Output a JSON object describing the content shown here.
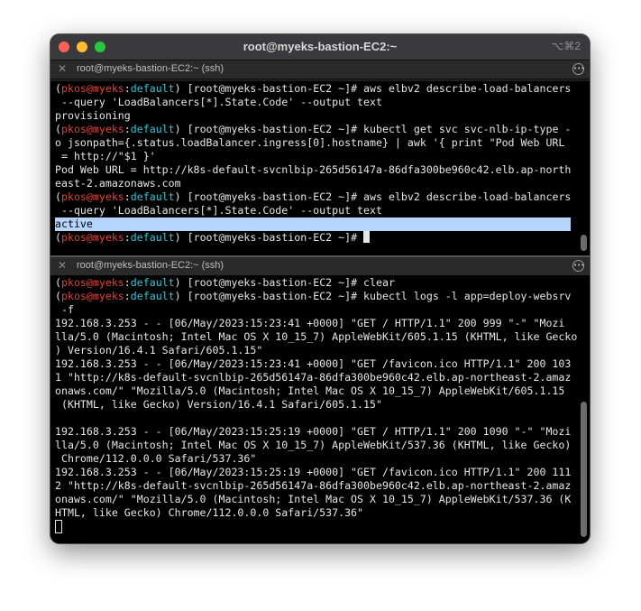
{
  "window": {
    "title": "root@myeks-bastion-EC2:~",
    "shortcut": "⌥⌘2"
  },
  "panes": [
    {
      "tab_title": "root@myeks-bastion-EC2:~ (ssh)",
      "lines": [
        {
          "user": "pkos",
          "at": "@",
          "host": "myeks",
          "colon": ":",
          "ctx": "default",
          "rest": ") [root@myeks-bastion-EC2 ~]# aws elbv2 describe-load-balancers"
        },
        {
          "text": " --query 'LoadBalancers[*].State.Code' --output text"
        },
        {
          "text": "provisioning"
        },
        {
          "user": "pkos",
          "at": "@",
          "host": "myeks",
          "colon": ":",
          "ctx": "default",
          "rest": ") [root@myeks-bastion-EC2 ~]# kubectl get svc svc-nlb-ip-type -"
        },
        {
          "text": "o jsonpath={.status.loadBalancer.ingress[0].hostname} | awk '{ print \"Pod Web URL"
        },
        {
          "text": " = http://\"$1 }'"
        },
        {
          "text": "Pod Web URL = http://k8s-default-svcnlbip-265d56147a-86dfa300be960c42.elb.ap-north"
        },
        {
          "text": "east-2.amazonaws.com"
        },
        {
          "user": "pkos",
          "at": "@",
          "host": "myeks",
          "colon": ":",
          "ctx": "default",
          "rest": ") [root@myeks-bastion-EC2 ~]# aws elbv2 describe-load-balancers"
        },
        {
          "text": " --query 'LoadBalancers[*].State.Code' --output text"
        },
        {
          "text": "active",
          "selected": true
        },
        {
          "user": "pkos",
          "at": "@",
          "host": "myeks",
          "colon": ":",
          "ctx": "default",
          "rest": ") [root@myeks-bastion-EC2 ~]# ",
          "cursor": "solid"
        }
      ]
    },
    {
      "tab_title": "root@myeks-bastion-EC2:~ (ssh)",
      "lines": [
        {
          "user": "pkos",
          "at": "@",
          "host": "myeks",
          "colon": ":",
          "ctx": "default",
          "rest": ") [root@myeks-bastion-EC2 ~]# clear"
        },
        {
          "user": "pkos",
          "at": "@",
          "host": "myeks",
          "colon": ":",
          "ctx": "default",
          "rest": ") [root@myeks-bastion-EC2 ~]# kubectl logs -l app=deploy-websrv"
        },
        {
          "text": " -f"
        },
        {
          "text": "192.168.3.253 - - [06/May/2023:15:23:41 +0000] \"GET / HTTP/1.1\" 200 999 \"-\" \"Mozi"
        },
        {
          "text": "lla/5.0 (Macintosh; Intel Mac OS X 10_15_7) AppleWebKit/605.1.15 (KHTML, like Gecko"
        },
        {
          "text": ") Version/16.4.1 Safari/605.1.15\""
        },
        {
          "text": "192.168.3.253 - - [06/May/2023:15:23:41 +0000] \"GET /favicon.ico HTTP/1.1\" 200 103"
        },
        {
          "text": "1 \"http://k8s-default-svcnlbip-265d56147a-86dfa300be960c42.elb.ap-northeast-2.amaz"
        },
        {
          "text": "onaws.com/\" \"Mozilla/5.0 (Macintosh; Intel Mac OS X 10_15_7) AppleWebKit/605.1.15"
        },
        {
          "text": " (KHTML, like Gecko) Version/16.4.1 Safari/605.1.15\""
        },
        {
          "text": ""
        },
        {
          "text": "192.168.3.253 - - [06/May/2023:15:25:19 +0000] \"GET / HTTP/1.1\" 200 1090 \"-\" \"Mozi"
        },
        {
          "text": "lla/5.0 (Macintosh; Intel Mac OS X 10_15_7) AppleWebKit/537.36 (KHTML, like Gecko)"
        },
        {
          "text": " Chrome/112.0.0.0 Safari/537.36\""
        },
        {
          "text": "192.168.3.253 - - [06/May/2023:15:25:19 +0000] \"GET /favicon.ico HTTP/1.1\" 200 111"
        },
        {
          "text": "2 \"http://k8s-default-svcnlbip-265d56147a-86dfa300be960c42.elb.ap-northeast-2.amaz"
        },
        {
          "text": "onaws.com/\" \"Mozilla/5.0 (Macintosh; Intel Mac OS X 10_15_7) AppleWebKit/537.36 (K"
        },
        {
          "text": "HTML, like Gecko) Chrome/112.0.0.0 Safari/537.36\""
        },
        {
          "text": "",
          "cursor": "hollow"
        }
      ]
    }
  ],
  "colors": {
    "prompt_user": "#e0413b",
    "prompt_context": "#2ec7d6",
    "selection": "#b5d5ff"
  },
  "icons": {
    "close_window": "red-traffic-light",
    "minimize_window": "yellow-traffic-light",
    "zoom_window": "green-traffic-light",
    "tab_close": "close-icon",
    "tab_menu": "ellipsis-menu-icon"
  }
}
